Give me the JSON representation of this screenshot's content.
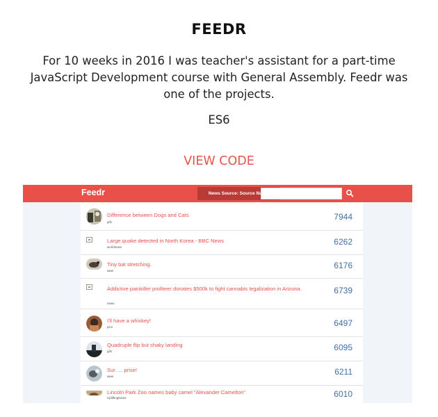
{
  "project": {
    "title": "FEEDR",
    "description": "For 10 weeks in 2016 I was teacher's assistant for a part-time JavaScript Development course with General Assembly. Feedr was one of the projects.",
    "tech": "ES6",
    "view_code_label": "VIEW CODE"
  },
  "screenshot": {
    "logo": "Feedr",
    "source_button": "News Source: Source Name",
    "search_value": "",
    "header_color": "#e9504a",
    "items": [
      {
        "title": "Difference between Dogs and Cats",
        "subreddit": "gifs",
        "count": "7944",
        "thumb": "photo"
      },
      {
        "title": "Large quake detected in North Korea - BBC News",
        "subreddit": "worldnews",
        "count": "6262",
        "thumb": "broken"
      },
      {
        "title": "Tiny bat stretching.",
        "subreddit": "aww",
        "count": "6176",
        "thumb": "photo"
      },
      {
        "title": "Addictive painkiller profiteer donates $500k to fight cannabis legalization in Arizona.",
        "subreddit": "news",
        "count": "6739",
        "thumb": "broken"
      },
      {
        "title": "I'll have a whiskey!",
        "subreddit": "pics",
        "count": "6497",
        "thumb": "photo"
      },
      {
        "title": "Quadruple flip but shaky landing",
        "subreddit": "gifs",
        "count": "6095",
        "thumb": "photo"
      },
      {
        "title": "Sur .... prise!",
        "subreddit": "aww",
        "count": "6211",
        "thumb": "photo"
      },
      {
        "title": "Lincoln Park Zoo names baby camel \"Alexander Camelton\"",
        "subreddit": "UpliftingNews",
        "count": "6010",
        "thumb": "photo"
      }
    ]
  }
}
